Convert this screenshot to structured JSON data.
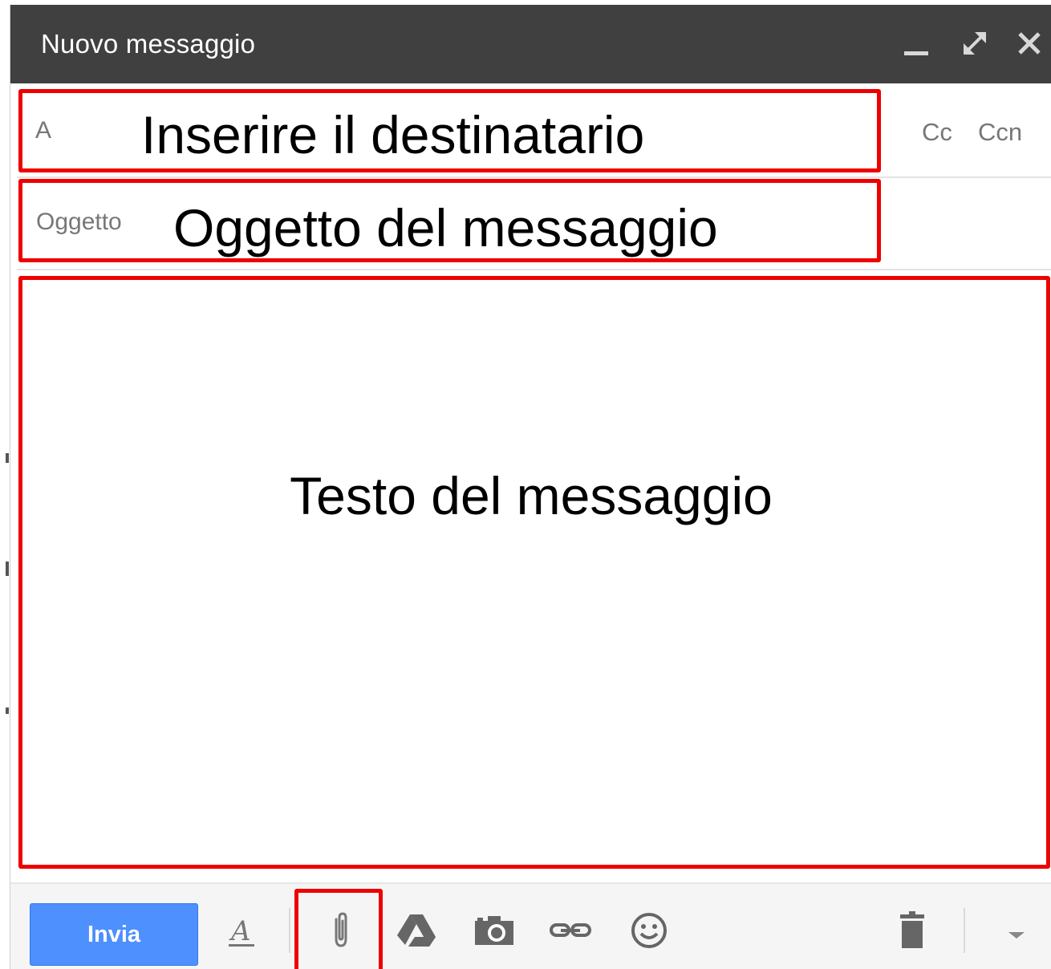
{
  "window": {
    "title": "Nuovo messaggio"
  },
  "titlebar_icons": [
    "minimize-icon",
    "fullscreen-icon",
    "close-icon"
  ],
  "fields": {
    "to_label": "A",
    "to_annotation": "Inserire il destinatario",
    "cc_label": "Cc",
    "bcc_label": "Ccn",
    "subject_label": "Oggetto",
    "subject_annotation": "Oggetto del messaggio"
  },
  "body": {
    "annotation": "Testo del messaggio"
  },
  "toolbar": {
    "send_label": "Invia",
    "icons": [
      "formatting-icon",
      "attachment-icon",
      "drive-icon",
      "photo-icon",
      "link-icon",
      "emoji-icon",
      "trash-icon",
      "more-options-icon"
    ]
  },
  "colors": {
    "titlebar": "#404040",
    "send_button": "#4d90fe",
    "highlight": "#ee0000"
  }
}
